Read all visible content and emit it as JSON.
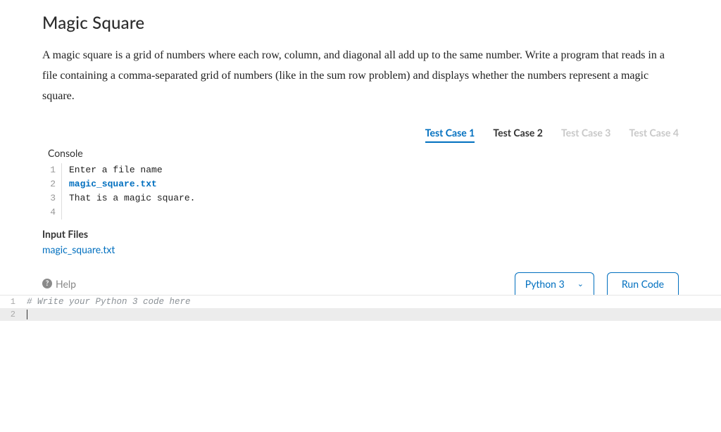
{
  "problem": {
    "title": "Magic Square",
    "description": "A magic square is a grid of numbers where each row, column, and diagonal all add up to the same number. Write a program that reads in a file containing a comma-separated grid of numbers (like in the sum row problem) and displays whether the numbers represent a magic square."
  },
  "test_tabs": [
    {
      "label": "Test Case 1",
      "state": "active"
    },
    {
      "label": "Test Case 2",
      "state": "enabled"
    },
    {
      "label": "Test Case 3",
      "state": "disabled"
    },
    {
      "label": "Test Case 4",
      "state": "disabled"
    }
  ],
  "console": {
    "label": "Console",
    "lines": [
      {
        "n": "1",
        "text": "Enter a file name",
        "kind": "output"
      },
      {
        "n": "2",
        "text": "magic_square.txt",
        "kind": "input"
      },
      {
        "n": "3",
        "text": "That is a magic square.",
        "kind": "output"
      },
      {
        "n": "4",
        "text": "",
        "kind": "output"
      }
    ]
  },
  "input_files": {
    "header": "Input Files",
    "files": [
      {
        "name": "magic_square.txt"
      }
    ]
  },
  "toolbar": {
    "help_label": "Help",
    "language_selected": "Python 3",
    "run_label": "Run Code"
  },
  "editor": {
    "lines": [
      {
        "n": "1",
        "text": "# Write your Python 3 code here",
        "kind": "comment"
      },
      {
        "n": "2",
        "text": "",
        "kind": "active"
      }
    ]
  }
}
